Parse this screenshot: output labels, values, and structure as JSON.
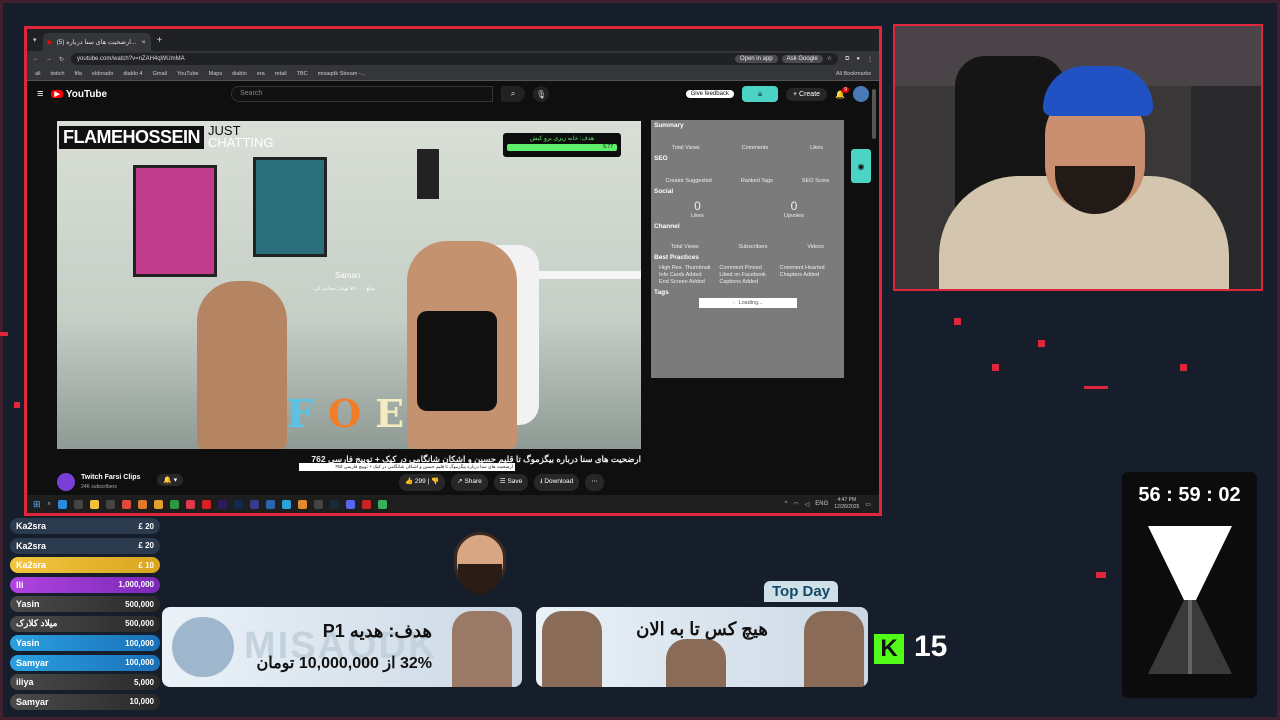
{
  "browser": {
    "tab_title": "(5) ارضحیت های سنا درباره...",
    "url": "youtube.com/watch?v=nZAH4qWUmMA",
    "open_in_app": "Open in app",
    "ask_google": "Ask Google",
    "bookmarks": [
      "all",
      "twitch",
      "fifa",
      "eldorado",
      "diablo 4",
      "Gmail",
      "YouTube",
      "Maps",
      "diablo",
      "era",
      "retail",
      "TBC",
      "misaqdk Stream -..."
    ],
    "all_bookmarks": "All Bookmarks"
  },
  "youtube": {
    "logo": "YouTube",
    "search_placeholder": "Search",
    "give_feedback": "Give feedback",
    "create": "Create",
    "notif_count": "9"
  },
  "video": {
    "overlay_title": "FLAMEHOSSEIN",
    "overlay_sub1": "JUST",
    "overlay_sub2": "CHATTING",
    "goal_text": "هدف: خانه زیزی برو کیش",
    "goal_pct": "5.77",
    "donor_name": "Saman",
    "donor_amount": "مبلغ ۷۶,۰۰۰ تومان حمایت کرد",
    "letters": [
      "F",
      "O",
      "E"
    ],
    "title": "ارضحیت های سنا درباره بیگزموگ تا قلیم حسین و اشکان شانگامی در کیک + توییج فارسی 762",
    "tooltip": "ارضحیت های سنا درباره بیگزموگ تا قلیم حسین و اشکان شانگامی در کیک + توییج فارسی 762",
    "channel": "Twitch Farsi Clips",
    "subs": "24K subscribers",
    "likes": "299",
    "share": "Share",
    "save": "Save",
    "download": "Download"
  },
  "panel": {
    "summary": "Summary",
    "summary_cols": [
      "Total Views",
      "Comments",
      "Likes"
    ],
    "seo": "SEO",
    "seo_cols": [
      "Creator Suggested",
      "Ranked Tags",
      "SEO Score"
    ],
    "social": "Social",
    "social_vals": [
      "0",
      "0"
    ],
    "social_labels": [
      "Likes",
      "Upvotes"
    ],
    "channel": "Channel",
    "channel_cols": [
      "Total Views",
      "Subscribers",
      "Videos"
    ],
    "best": "Best Practices",
    "best_items": [
      "High Res. Thumbnail",
      "Comment Pinned",
      "Comment Hearted",
      "Info Cards Added",
      "Liked on Facebook",
      "Chapters Added",
      "End Screen Added",
      "Captions Added"
    ],
    "tags": "Tags",
    "loading": "Loading..."
  },
  "taskbar": {
    "lang": "ENG",
    "time": "4:47 PM",
    "date": "12/26/2025"
  },
  "donors": [
    {
      "name": "Ka2sra",
      "amount": "£ 20"
    },
    {
      "name": "Ka2sra",
      "amount": "£ 20"
    },
    {
      "name": "Ka2sra",
      "amount": "£ 10"
    },
    {
      "name": "lli",
      "amount": "1,000,000"
    },
    {
      "name": "Yasin",
      "amount": "500,000"
    },
    {
      "name": "میلاد کلارک",
      "amount": "500,000"
    },
    {
      "name": "Yasin",
      "amount": "100,000"
    },
    {
      "name": "Samyar",
      "amount": "100,000"
    },
    {
      "name": "iliya",
      "amount": "5,000"
    },
    {
      "name": "Samyar",
      "amount": "10,000"
    }
  ],
  "goal_banner": {
    "line1": "هدف: هدیه P1",
    "line2": "32% از 10,000,000 تومان",
    "watermark": "MISAQDK"
  },
  "top_day": {
    "label": "Top Day",
    "text": "هیچ کس تا به الان"
  },
  "kick": {
    "count": "15"
  },
  "timer": {
    "value": "56 : 59 : 02"
  },
  "colors": {
    "accent": "#e0263b",
    "kick": "#53fc18"
  }
}
